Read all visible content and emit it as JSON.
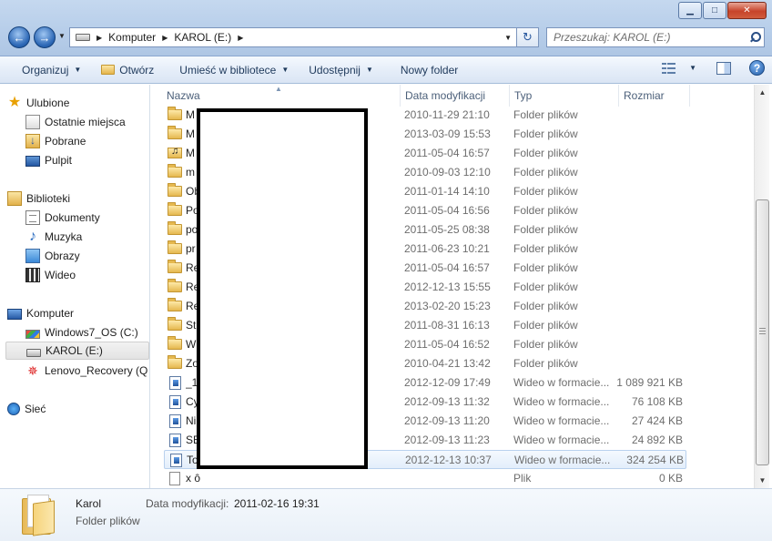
{
  "window": {
    "minimize_glyph": "▁",
    "maximize_glyph": "□",
    "close_glyph": "✕"
  },
  "address": {
    "crumbs": [
      "Komputer",
      "KAROL (E:)"
    ],
    "search_placeholder": "Przeszukaj: KAROL (E:)"
  },
  "toolbar": {
    "organize": "Organizuj",
    "open": "Otwórz",
    "add_to_library": "Umieść w bibliotece",
    "share": "Udostępnij",
    "new_folder": "Nowy folder"
  },
  "nav": {
    "favorites": "Ulubione",
    "recent": "Ostatnie miejsca",
    "downloads": "Pobrane",
    "desktop": "Pulpit",
    "libraries": "Biblioteki",
    "documents": "Dokumenty",
    "music": "Muzyka",
    "pictures": "Obrazy",
    "videos": "Wideo",
    "computer": "Komputer",
    "drive_c": "Windows7_OS (C:)",
    "drive_e": "KAROL (E:)",
    "drive_q": "Lenovo_Recovery (Q",
    "network": "Sieć"
  },
  "columns": {
    "name": "Nazwa",
    "date": "Data modyfikacji",
    "type": "Typ",
    "size": "Rozmiar"
  },
  "files": [
    {
      "name": "M",
      "date": "2010-11-29 21:10",
      "type": "Folder plików",
      "size": "",
      "icon": "folder"
    },
    {
      "name": "M",
      "date": "2013-03-09 15:53",
      "type": "Folder plików",
      "size": "",
      "icon": "folder"
    },
    {
      "name": "M",
      "date": "2011-05-04 16:57",
      "type": "Folder plików",
      "size": "",
      "icon": "folder-special"
    },
    {
      "name": "m",
      "date": "2010-09-03 12:10",
      "type": "Folder plików",
      "size": "",
      "icon": "folder"
    },
    {
      "name": "Ob",
      "date": "2011-01-14 14:10",
      "type": "Folder plików",
      "size": "",
      "icon": "folder"
    },
    {
      "name": "Po",
      "date": "2011-05-04 16:56",
      "type": "Folder plików",
      "size": "",
      "icon": "folder"
    },
    {
      "name": "po",
      "date": "2011-05-25 08:38",
      "type": "Folder plików",
      "size": "",
      "icon": "folder"
    },
    {
      "name": "pr",
      "date": "2011-06-23 10:21",
      "type": "Folder plików",
      "size": "",
      "icon": "folder"
    },
    {
      "name": "Re",
      "date": "2011-05-04 16:57",
      "type": "Folder plików",
      "size": "",
      "icon": "folder"
    },
    {
      "name": "Re",
      "date": "2012-12-13 15:55",
      "type": "Folder plików",
      "size": "",
      "icon": "folder"
    },
    {
      "name": "Re",
      "date": "2013-02-20 15:23",
      "type": "Folder plików",
      "size": "",
      "icon": "folder"
    },
    {
      "name": "St",
      "date": "2011-08-31 16:13",
      "type": "Folder plików",
      "size": "",
      "icon": "folder"
    },
    {
      "name": "W",
      "date": "2011-05-04 16:52",
      "type": "Folder plików",
      "size": "",
      "icon": "folder"
    },
    {
      "name": "Zo",
      "date": "2010-04-21 13:42",
      "type": "Folder plików",
      "size": "",
      "icon": "folder"
    },
    {
      "name": "_1",
      "date": "2012-12-09 17:49",
      "type": "Wideo w formacie...",
      "size": "1 089 921 KB",
      "icon": "video"
    },
    {
      "name": "Cy",
      "date": "2012-09-13 11:32",
      "type": "Wideo w formacie...",
      "size": "76 108 KB",
      "icon": "video"
    },
    {
      "name": "Ni",
      "date": "2012-09-13 11:20",
      "type": "Wideo w formacie...",
      "size": "27 424 KB",
      "icon": "video"
    },
    {
      "name": "SE",
      "date": "2012-09-13 11:23",
      "type": "Wideo w formacie...",
      "size": "24 892 KB",
      "icon": "video"
    },
    {
      "name": "To",
      "date": "2012-12-13 10:37",
      "type": "Wideo w formacie...",
      "size": "324 254 KB",
      "icon": "video"
    },
    {
      "name": "x    ô",
      "date": "",
      "type": "Plik",
      "size": "0 KB",
      "icon": "file"
    }
  ],
  "details": {
    "name": "Karol",
    "type": "Folder plików",
    "modified_label": "Data modyfikacji:",
    "modified_value": "2011-02-16 19:31"
  },
  "colors": {
    "title_bar": "#b6cde9",
    "toolbar": "#e6eef9",
    "highlight_border": "#b9d1ee",
    "close_button": "#c7432a"
  }
}
